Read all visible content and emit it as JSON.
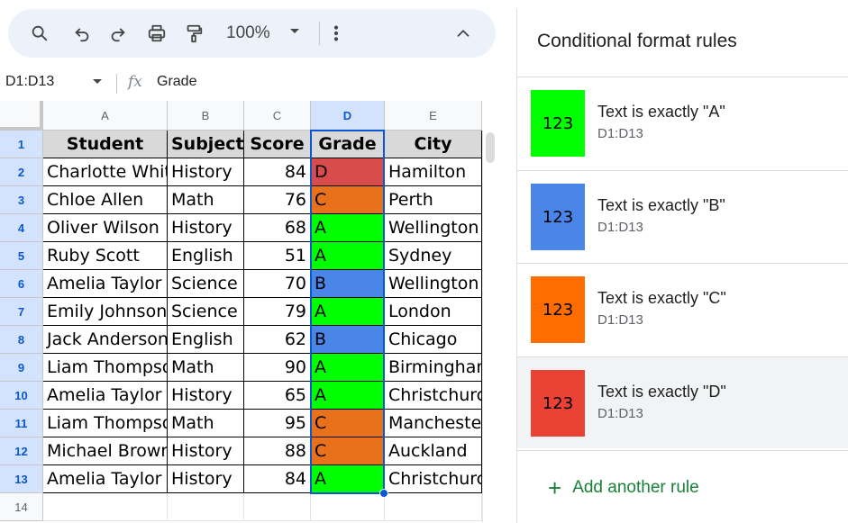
{
  "toolbar": {
    "zoom": "100%",
    "icons": [
      "search-icon",
      "undo-icon",
      "redo-icon",
      "print-icon",
      "paint-format-icon",
      "caret-down-icon",
      "more-vert-icon",
      "chevron-up-icon"
    ]
  },
  "formula_bar": {
    "name_box": "D1:D13",
    "fx_label": "fx",
    "content": "Grade"
  },
  "grid": {
    "columns": [
      "A",
      "B",
      "C",
      "D",
      "E"
    ],
    "rows": [
      "1",
      "2",
      "3",
      "4",
      "5",
      "6",
      "7",
      "8",
      "9",
      "10",
      "11",
      "12",
      "13",
      "14"
    ],
    "header": [
      "Student",
      "Subject",
      "Score",
      "Grade",
      "City"
    ],
    "data": [
      [
        "Charlotte White",
        "History",
        "84",
        "D",
        "Hamilton"
      ],
      [
        "Chloe Allen",
        "Math",
        "76",
        "C",
        "Perth"
      ],
      [
        "Oliver Wilson",
        "History",
        "68",
        "A",
        "Wellington"
      ],
      [
        "Ruby Scott",
        "English",
        "51",
        "A",
        "Sydney"
      ],
      [
        "Amelia Taylor",
        "Science",
        "70",
        "B",
        "Wellington"
      ],
      [
        "Emily Johnson",
        "Science",
        "79",
        "A",
        "London"
      ],
      [
        "Jack Anderson",
        "English",
        "62",
        "B",
        "Chicago"
      ],
      [
        "Liam Thompson",
        "Math",
        "90",
        "A",
        "Birmingham"
      ],
      [
        "Amelia Taylor",
        "History",
        "65",
        "A",
        "Christchurch"
      ],
      [
        "Liam Thompson",
        "Math",
        "95",
        "C",
        "Manchester"
      ],
      [
        "Michael Brown",
        "History",
        "88",
        "C",
        "Auckland"
      ],
      [
        "Amelia Taylor",
        "History",
        "84",
        "A",
        "Christchurch"
      ]
    ],
    "grade_colors": {
      "A": "#00ff00",
      "B": "#4a86e8",
      "C": "#e8711c",
      "D": "#d94c4c"
    }
  },
  "panel": {
    "title": "Conditional format rules",
    "rules": [
      {
        "sample": "123",
        "title": "Text is exactly \"A\"",
        "range": "D1:D13",
        "color": "#00ff00"
      },
      {
        "sample": "123",
        "title": "Text is exactly \"B\"",
        "range": "D1:D13",
        "color": "#4a86e8"
      },
      {
        "sample": "123",
        "title": "Text is exactly \"C\"",
        "range": "D1:D13",
        "color": "#ff6d01"
      },
      {
        "sample": "123",
        "title": "Text is exactly \"D\"",
        "range": "D1:D13",
        "color": "#ea4335"
      }
    ],
    "add_rule": {
      "icon": "plus-icon",
      "label": "Add another rule"
    }
  },
  "colors": {
    "selection": "#0b57d0",
    "header_fill": "#d9d9d9",
    "toolbar_bg": "#edf2fa",
    "add_rule": "#188038"
  }
}
